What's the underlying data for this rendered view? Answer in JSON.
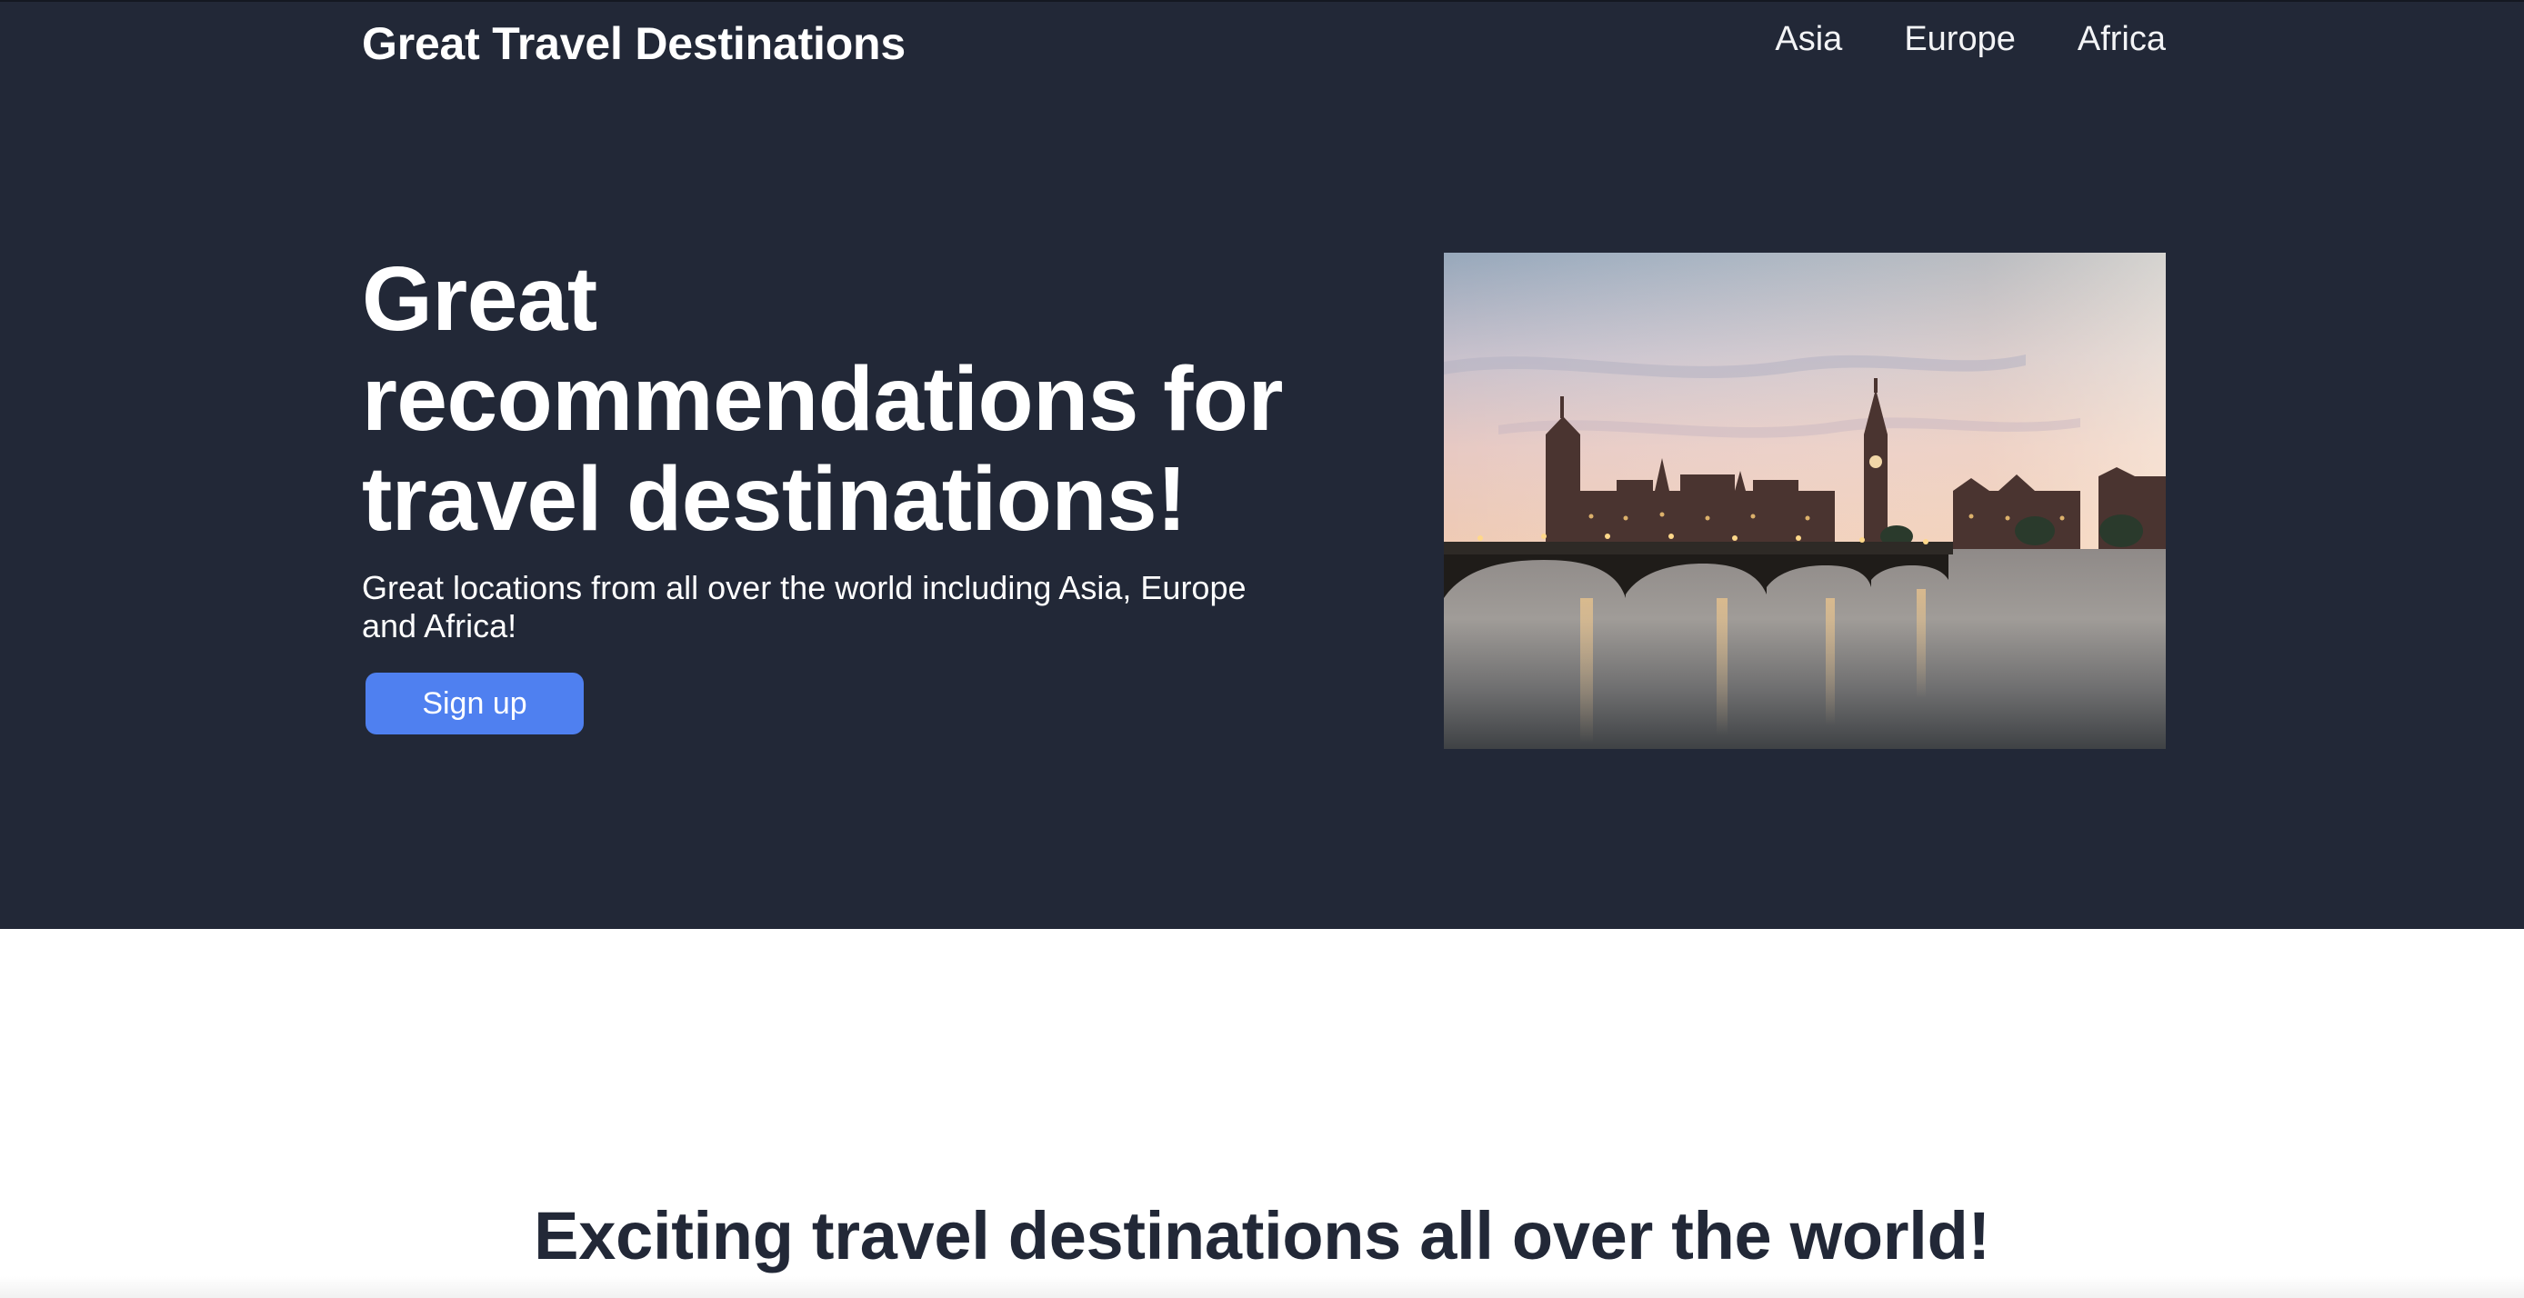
{
  "header": {
    "site_title": "Great Travel Destinations",
    "nav": [
      {
        "label": "Asia"
      },
      {
        "label": "Europe"
      },
      {
        "label": "Africa"
      }
    ]
  },
  "hero": {
    "title": "Great recommendations for travel destinations!",
    "subtitle": "Great locations from all over the world including Asia, Europe and Africa!",
    "cta_label": "Sign up",
    "image_icon": "london-skyline-photo"
  },
  "section": {
    "title": "Exciting travel destinations all over the world!"
  },
  "colors": {
    "hero_background": "#222837",
    "accent": "#4f80f0",
    "section_title": "#222837",
    "page_background": "#ffffff"
  }
}
